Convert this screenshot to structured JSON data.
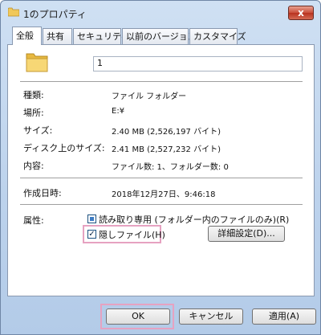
{
  "window": {
    "title": "1のプロパティ"
  },
  "titlebar": {
    "close_label": "x"
  },
  "tabs": [
    {
      "label": "全般"
    },
    {
      "label": "共有"
    },
    {
      "label": "セキュリティ"
    },
    {
      "label": "以前のバージョン"
    },
    {
      "label": "カスタマイズ"
    }
  ],
  "general": {
    "name_value": "1",
    "rows": [
      {
        "label": "種類:",
        "value": "ファイル フォルダー"
      },
      {
        "label": "場所:",
        "value": "E:¥"
      },
      {
        "label": "サイズ:",
        "value": "2.40 MB (2,526,197 バイト)"
      },
      {
        "label": "ディスク上のサイズ:",
        "value": "2.41 MB (2,527,232 バイト)"
      },
      {
        "label": "内容:",
        "value": "ファイル数: 1、フォルダー数: 0"
      },
      {
        "label": "作成日時:",
        "value": "2018年12月27日、9:46:18"
      }
    ],
    "attributes": {
      "label": "属性:",
      "readonly_label": "読み取り専用 (フォルダー内のファイルのみ)(R)",
      "readonly_state": "indeterminate",
      "hidden_label": "隠しファイル(H)",
      "hidden_checked": true,
      "hidden_mark": "✓",
      "advanced_label": "詳細設定(D)..."
    }
  },
  "footer": {
    "ok_label": "OK",
    "cancel_label": "キャンセル",
    "apply_label": "適用(A)"
  },
  "colors": {
    "highlight": "#e6a2c1",
    "accent": "#3d7bc4"
  }
}
